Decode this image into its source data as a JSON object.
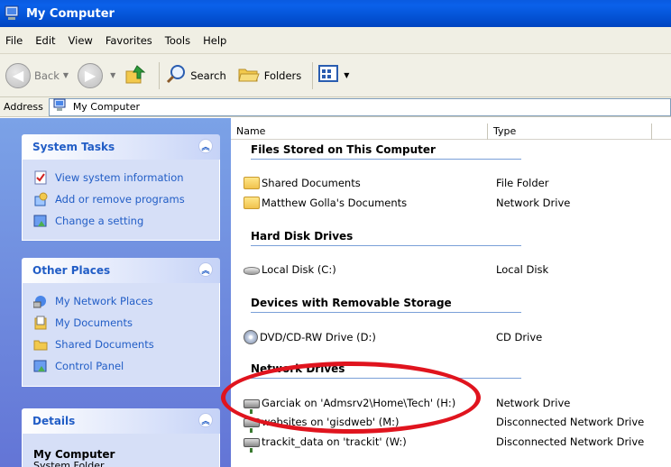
{
  "window": {
    "title": "My Computer"
  },
  "menu": [
    "File",
    "Edit",
    "View",
    "Favorites",
    "Tools",
    "Help"
  ],
  "toolbar": {
    "back": "Back",
    "search": "Search",
    "folders": "Folders"
  },
  "address": {
    "label": "Address",
    "value": "My Computer"
  },
  "tasks": {
    "system": {
      "title": "System Tasks",
      "items": [
        "View system information",
        "Add or remove programs",
        "Change a setting"
      ]
    },
    "other": {
      "title": "Other Places",
      "items": [
        "My Network Places",
        "My Documents",
        "Shared Documents",
        "Control Panel"
      ]
    },
    "details": {
      "title": "Details",
      "name": "My Computer",
      "sub": "System Folder"
    }
  },
  "columns": {
    "name": "Name",
    "type": "Type"
  },
  "groups": [
    {
      "title": "Files Stored on This Computer",
      "items": [
        {
          "name": "Shared Documents",
          "type": "File Folder"
        },
        {
          "name": "Matthew Golla's Documents",
          "type": "Network Drive"
        }
      ]
    },
    {
      "title": "Hard Disk Drives",
      "items": [
        {
          "name": "Local Disk (C:)",
          "type": "Local Disk"
        }
      ]
    },
    {
      "title": "Devices with Removable Storage",
      "items": [
        {
          "name": "DVD/CD-RW Drive (D:)",
          "type": "CD Drive"
        }
      ]
    },
    {
      "title": "Network Drives",
      "items": [
        {
          "name": "Garciak on 'Admsrv2\\Home\\Tech' (H:)",
          "type": "Network Drive"
        },
        {
          "name": "websites on 'gisdweb' (M:)",
          "type": "Disconnected Network Drive"
        },
        {
          "name": "trackit_data on 'trackit' (W:)",
          "type": "Disconnected Network Drive"
        }
      ]
    }
  ],
  "colors": {
    "title_bar": "#0453d6",
    "task_text": "#215dc6",
    "highlight": "#e0141e"
  }
}
